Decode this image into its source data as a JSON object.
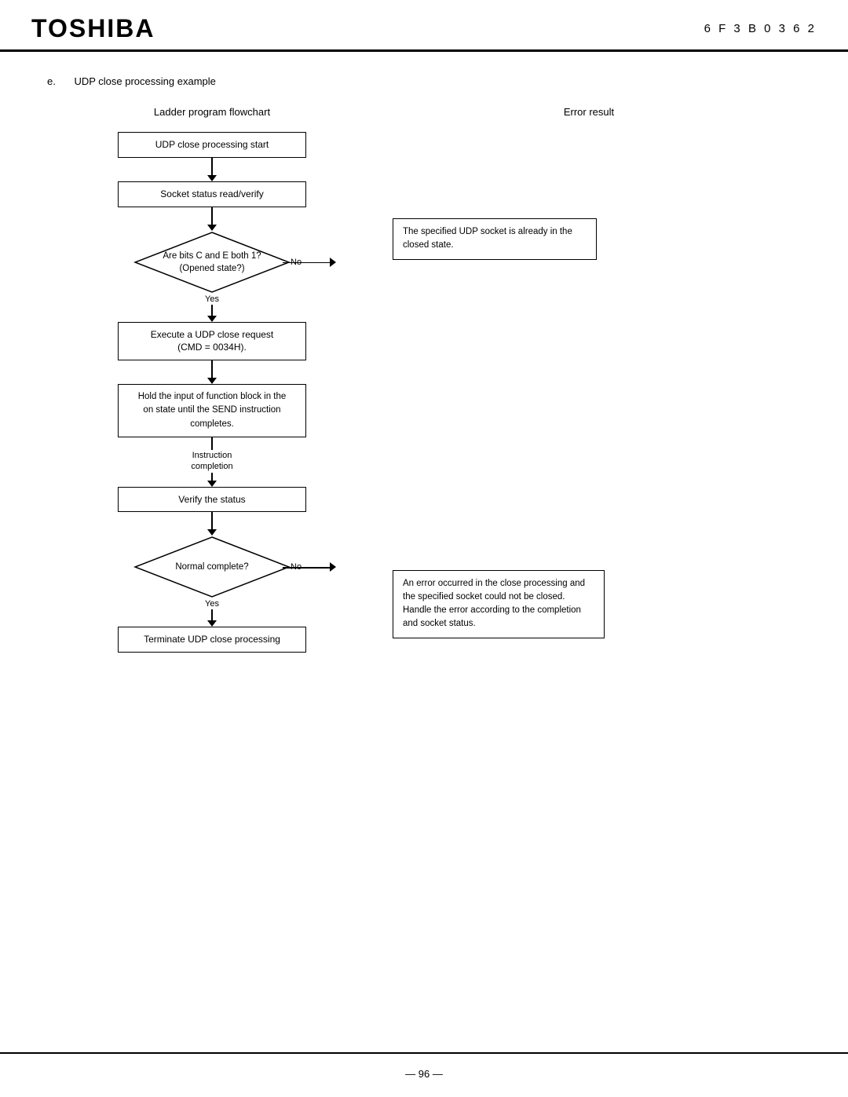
{
  "header": {
    "logo": "TOSHIBA",
    "doc_number": "6 F 3 B 0 3 6 2"
  },
  "section": {
    "label": "e.",
    "title": "UDP close processing example"
  },
  "columns": {
    "left_header": "Ladder program flowchart",
    "right_header": "Error result"
  },
  "flowchart": {
    "nodes": [
      {
        "id": "start",
        "type": "rect",
        "text": "UDP close processing start"
      },
      {
        "id": "socket_status",
        "type": "rect",
        "text": "Socket status read/verify"
      },
      {
        "id": "diamond1",
        "type": "diamond",
        "text": "Are bits C and E both 1?\n(Opened state?)",
        "yes": "Yes",
        "no": "No"
      },
      {
        "id": "execute_close",
        "type": "rect",
        "text": "Execute a UDP close request\n(CMD = 0034H)."
      },
      {
        "id": "hold_input",
        "type": "rect",
        "text": "Hold the input of function block in the\non state until the SEND instruction\ncompletes."
      },
      {
        "id": "verify_status",
        "type": "rect",
        "text": "Verify the status"
      },
      {
        "id": "diamond2",
        "type": "diamond",
        "text": "Normal complete?",
        "yes": "Yes",
        "no": "No"
      },
      {
        "id": "terminate",
        "type": "rect",
        "text": "Terminate UDP close processing"
      }
    ],
    "instruction_completion_label": "Instruction\ncompletion"
  },
  "error_boxes": {
    "box1": {
      "text": "The specified UDP socket is already in the\nclosed state.",
      "position": "diamond1"
    },
    "box2": {
      "text": "An error occurred in the close processing\nand the specified socket could not be\nclosed.\nHandle the error according to the\ncompletion and socket status.",
      "position": "diamond2"
    }
  },
  "footer": {
    "page_number": "— 96 —"
  }
}
